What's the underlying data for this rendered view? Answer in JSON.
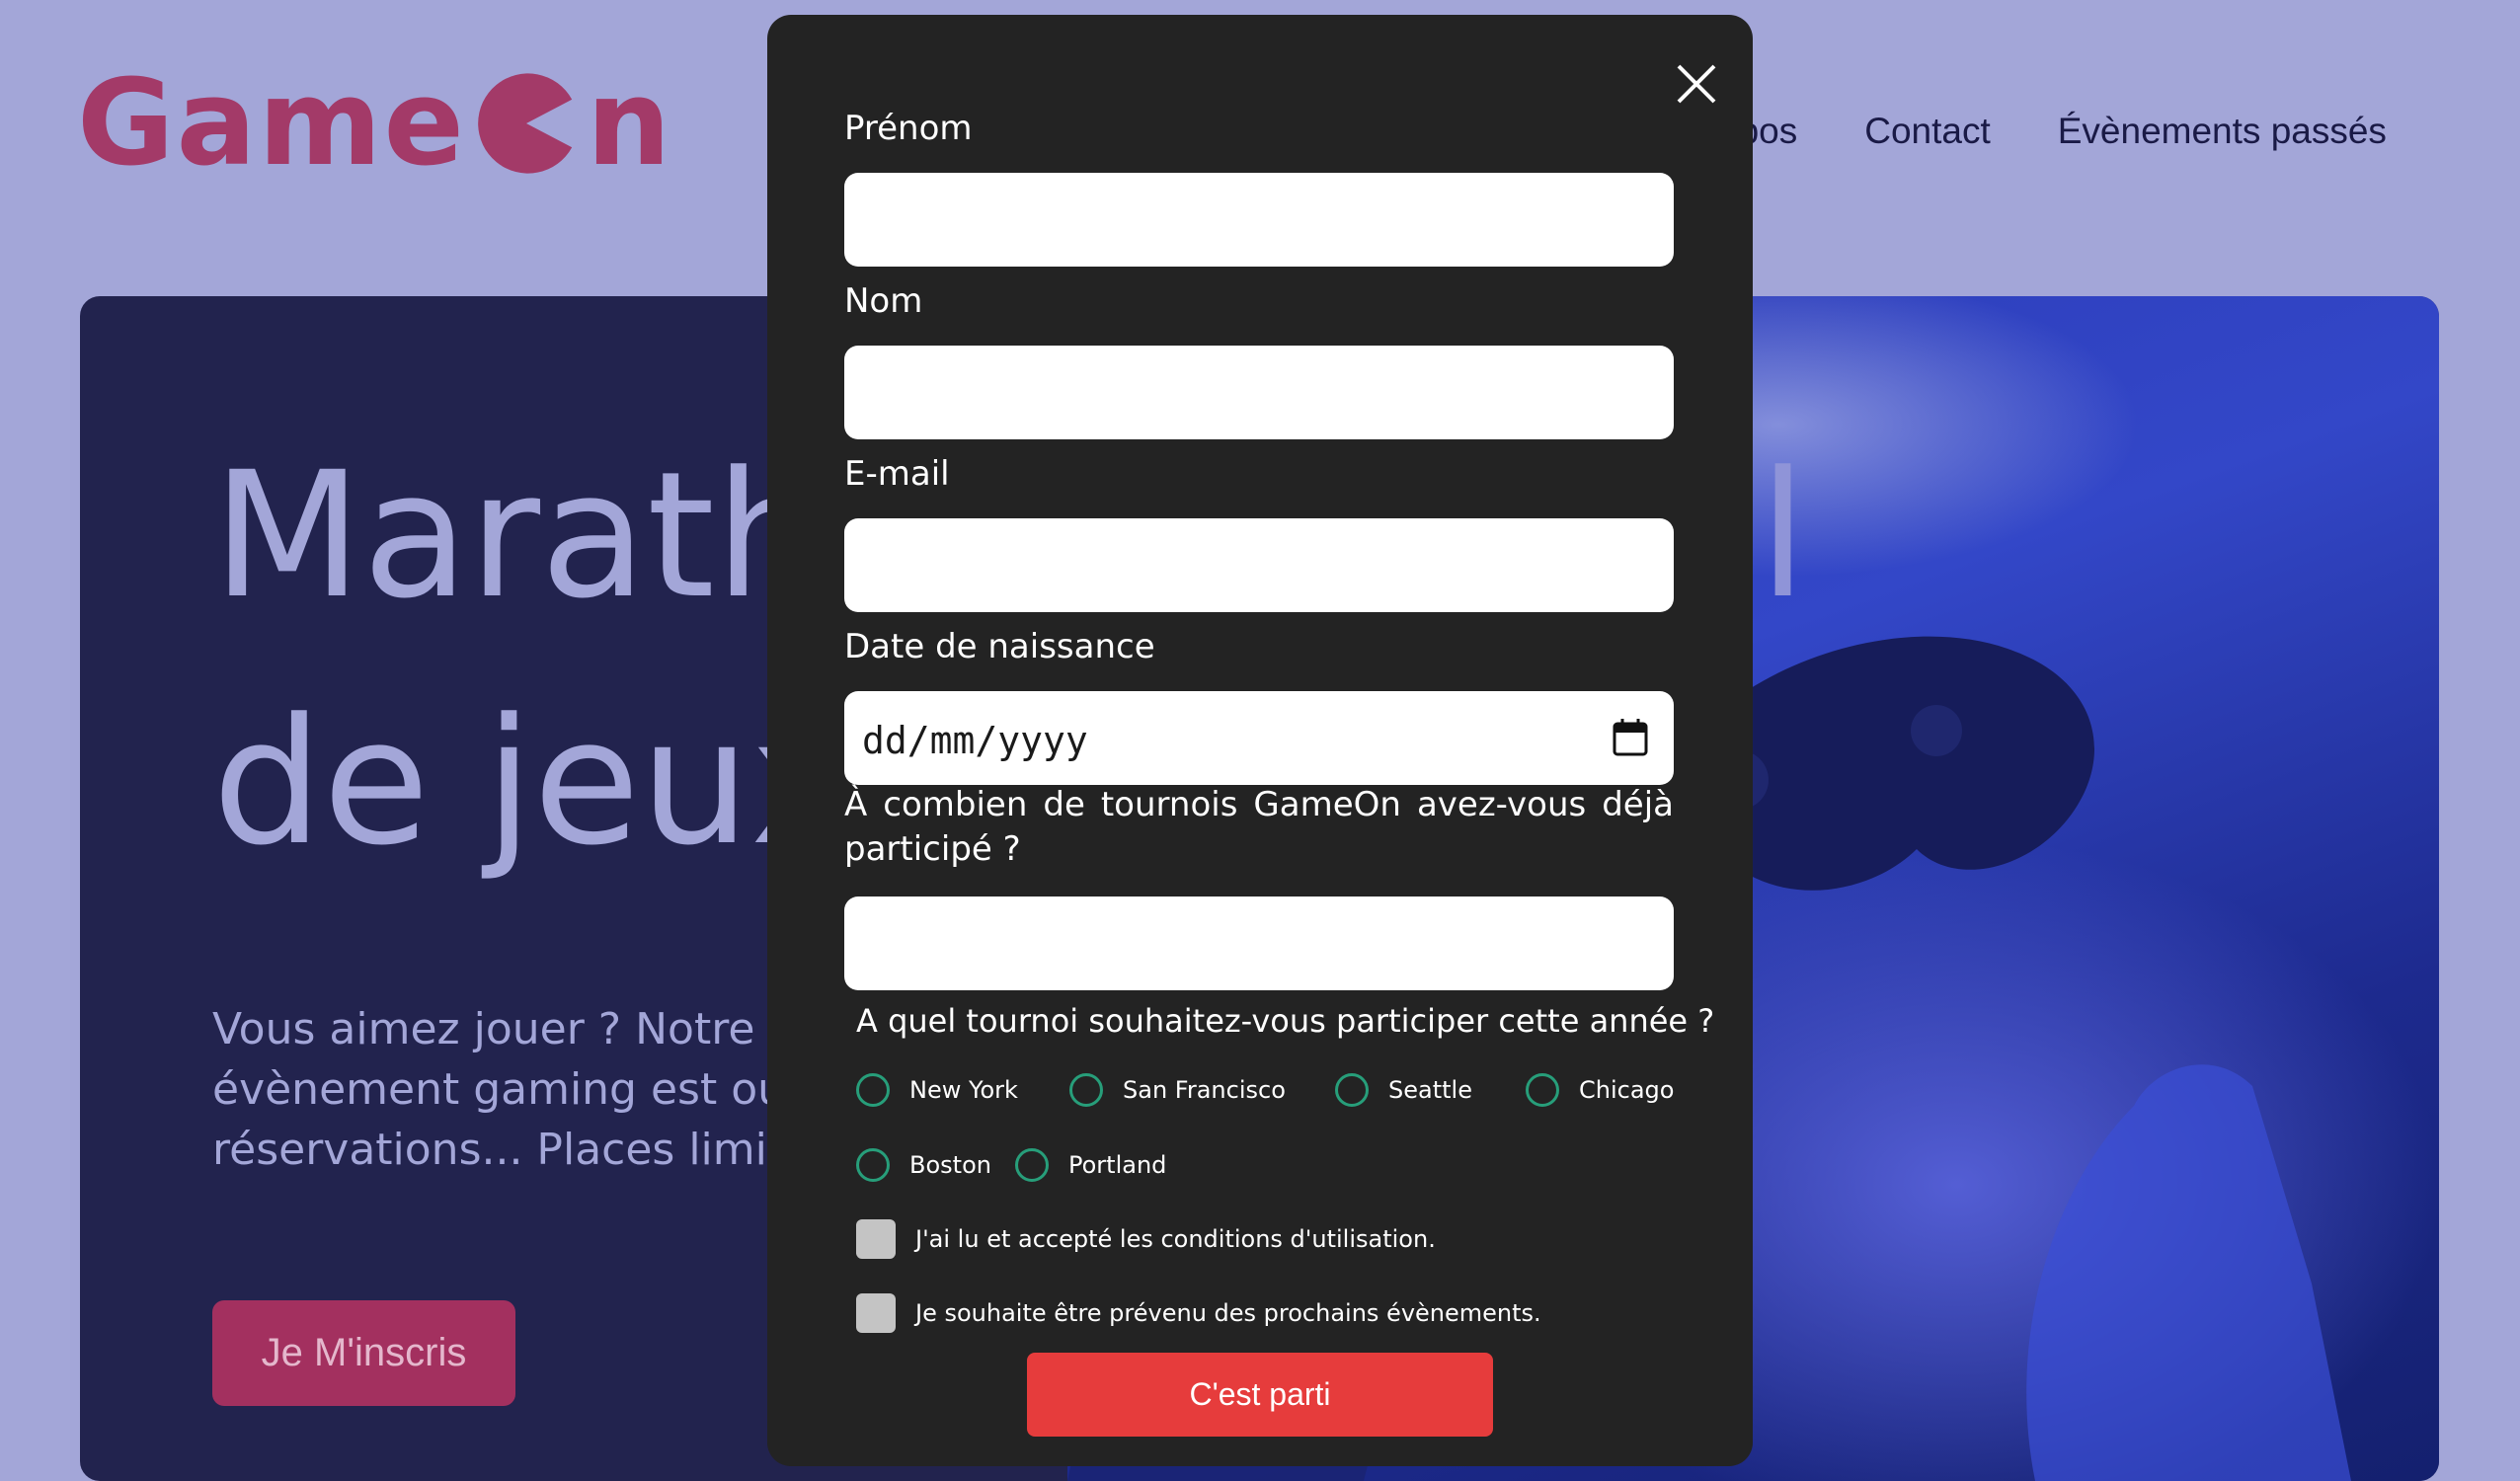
{
  "header": {
    "logo_prefix": "Game",
    "logo_suffix": "n",
    "nav": [
      "opos",
      "Contact",
      "Évènements passés"
    ]
  },
  "hero": {
    "title_line1": "Marath",
    "title_line2": "de jeux",
    "title_fragment_right": "l",
    "subtitle_line1": "Vous aimez jouer ? Notre p",
    "subtitle_line2": "évènement gaming est ouv",
    "subtitle_line3": "réservations... Places limite",
    "cta_label": "Je M'inscris"
  },
  "modal": {
    "close_icon": "close-icon",
    "fields": {
      "first_name_label": "Prénom",
      "last_name_label": "Nom",
      "email_label": "E-mail",
      "birthdate_label": "Date de naissance",
      "birthdate_placeholder": "dd/mm/yyyy",
      "tournaments_label": "À combien de tournois GameOn avez-vous déjà participé ?"
    },
    "location_question": "A quel tournoi souhaitez-vous participer cette année ?",
    "locations": [
      "New York",
      "San Francisco",
      "Seattle",
      "Chicago",
      "Boston",
      "Portland"
    ],
    "checkboxes": {
      "terms": "J'ai lu et accepté les conditions d'utilisation.",
      "newsletter": "Je souhaite être prévenu des prochains évènements."
    },
    "submit_label": "C'est parti"
  },
  "colors": {
    "page_bg": "#a3a6d8",
    "brand": "#a33a68",
    "modal_bg": "#232323",
    "radio_ring": "#279e7a",
    "submit": "#e63c3c"
  }
}
